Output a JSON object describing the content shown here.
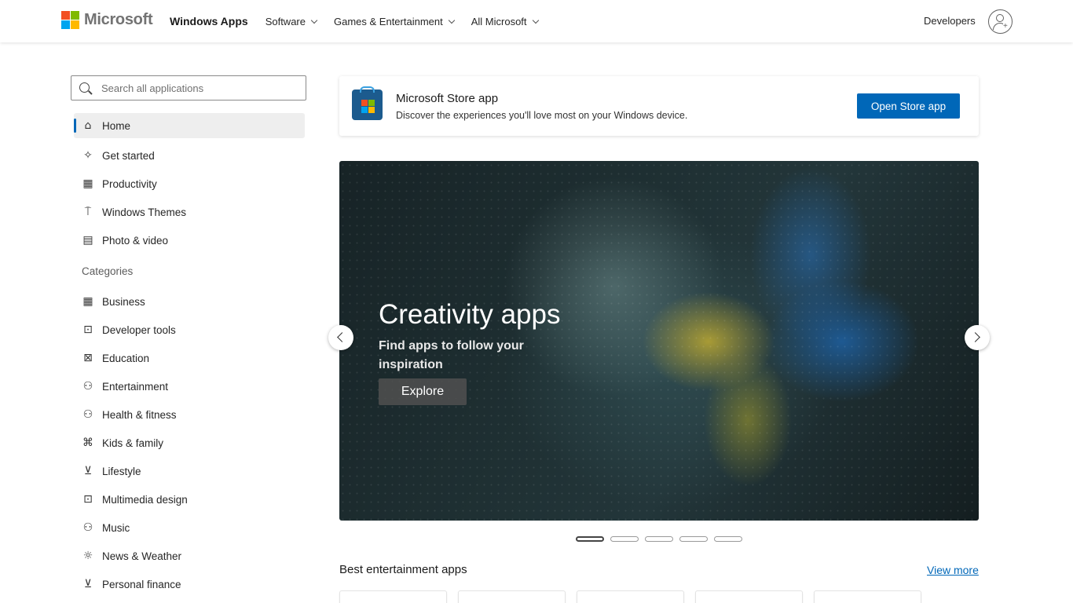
{
  "header": {
    "logo_text": "Microsoft",
    "nav": [
      {
        "label": "Windows Apps",
        "dropdown": false
      },
      {
        "label": "Software",
        "dropdown": true
      },
      {
        "label": "Games & Entertainment",
        "dropdown": true
      },
      {
        "label": "All Microsoft",
        "dropdown": true
      }
    ],
    "developers": "Developers"
  },
  "sidebar": {
    "search_placeholder": "Search all applications",
    "top_items": [
      {
        "label": "Home",
        "icon": "home-icon",
        "active": true
      },
      {
        "label": "Get started",
        "icon": "sparkle-icon"
      },
      {
        "label": "Productivity",
        "icon": "productivity-icon"
      },
      {
        "label": "Windows Themes",
        "icon": "paintbrush-icon"
      },
      {
        "label": "Photo & video",
        "icon": "photo-icon"
      }
    ],
    "categories_label": "Categories",
    "categories": [
      {
        "label": "Business",
        "icon": "business-icon"
      },
      {
        "label": "Developer tools",
        "icon": "developer-icon"
      },
      {
        "label": "Education",
        "icon": "education-icon"
      },
      {
        "label": "Entertainment",
        "icon": "entertainment-icon"
      },
      {
        "label": "Health & fitness",
        "icon": "health-icon"
      },
      {
        "label": "Kids & family",
        "icon": "kids-icon"
      },
      {
        "label": "Lifestyle",
        "icon": "cart-icon"
      },
      {
        "label": "Multimedia design",
        "icon": "multimedia-icon"
      },
      {
        "label": "Music",
        "icon": "music-icon"
      },
      {
        "label": "News & Weather",
        "icon": "weather-icon"
      },
      {
        "label": "Personal finance",
        "icon": "finance-icon"
      }
    ]
  },
  "store_banner": {
    "title": "Microsoft Store app",
    "description": "Discover the experiences you'll love most on your Windows device.",
    "button": "Open Store app"
  },
  "hero": {
    "title": "Creativity apps",
    "subtitle": "Find apps to follow your inspiration",
    "button": "Explore",
    "slide_count": 5,
    "active_slide": 1
  },
  "section": {
    "title": "Best entertainment apps",
    "view_more": "View more"
  },
  "colors": {
    "accent": "#0067b8",
    "logo_red": "#f25022",
    "logo_green": "#7fba00",
    "logo_blue": "#00a4ef",
    "logo_yellow": "#ffb900"
  }
}
